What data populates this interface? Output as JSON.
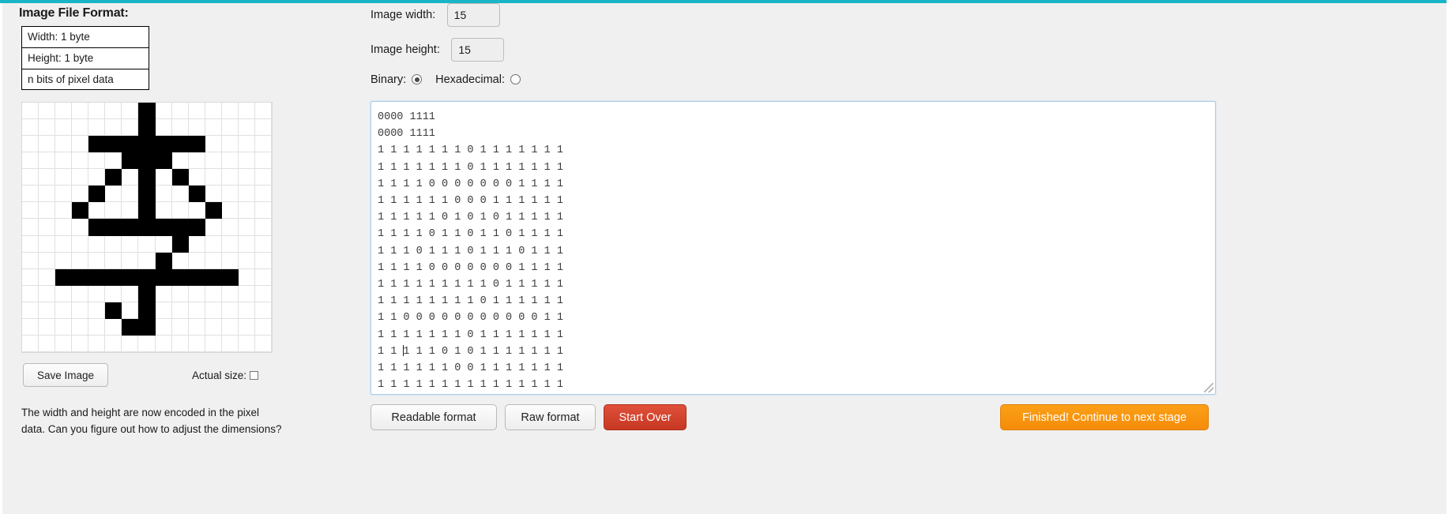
{
  "theme": {
    "accent_top_bar": "#1ab4c8",
    "page_background": "#f0f0f0",
    "start_over_color": "#c63823",
    "finished_color": "#f58c0a",
    "pixel_on_color": "#000000",
    "pixel_off_color": "#ffffff"
  },
  "left": {
    "format_title": "Image File Format:",
    "format_rows": [
      "Width: 1 byte",
      "Height: 1 byte",
      "n bits of pixel data"
    ],
    "save_image_label": "Save Image",
    "actual_size_label": "Actual size:",
    "actual_size_checked": false,
    "hint_text": "The width and height are now encoded in the pixel data. Can you figure out how to adjust the dimensions?"
  },
  "right": {
    "image_width_label": "Image width:",
    "image_width_value": "15",
    "image_height_label": "Image height:",
    "image_height_value": "15",
    "binary_label": "Binary:",
    "hexadecimal_label": "Hexadecimal:",
    "binary_selected": true,
    "hexadecimal_selected": false,
    "buttons": {
      "readable_format": "Readable format",
      "raw_format": "Raw format",
      "start_over": "Start Over",
      "finished": "Finished! Continue to next stage"
    }
  },
  "binary_editor": {
    "header_lines": [
      "0000 1111",
      "0000 1111"
    ],
    "caret_line_index": 12,
    "caret_char_index": 4,
    "pixel_lines": [
      "1 1 1 1 1 1 1 0 1 1 1 1 1 1 1",
      "1 1 1 1 1 1 1 0 1 1 1 1 1 1 1",
      "1 1 1 1 0 0 0 0 0 0 0 1 1 1 1",
      "1 1 1 1 1 1 0 0 0 1 1 1 1 1 1",
      "1 1 1 1 1 0 1 0 1 0 1 1 1 1 1",
      "1 1 1 1 0 1 1 0 1 1 0 1 1 1 1",
      "1 1 1 0 1 1 1 0 1 1 1 0 1 1 1",
      "1 1 1 1 0 0 0 0 0 0 0 1 1 1 1",
      "1 1 1 1 1 1 1 1 1 0 1 1 1 1 1",
      "1 1 1 1 1 1 1 1 0 1 1 1 1 1 1",
      "1 1 0 0 0 0 0 0 0 0 0 0 0 1 1",
      "1 1 1 1 1 1 1 0 1 1 1 1 1 1 1",
      "1 1 1 1 1 0 1 0 1 1 1 1 1 1 1",
      "1 1 1 1 1 1 0 0 1 1 1 1 1 1 1",
      "1 1 1 1 1 1 1 1 1 1 1 1 1 1 1"
    ]
  },
  "pixel_grid": {
    "width": 15,
    "height": 15,
    "rows": [
      "111111101111111",
      "111111101111111",
      "111100000001111",
      "111111000111111",
      "111110101011111",
      "111101101101111",
      "111011101110111",
      "111100000001111",
      "111111111011111",
      "111111110111111",
      "110000000000011",
      "111111101111111",
      "111110101111111",
      "111111001111111",
      "111111111111111"
    ]
  }
}
